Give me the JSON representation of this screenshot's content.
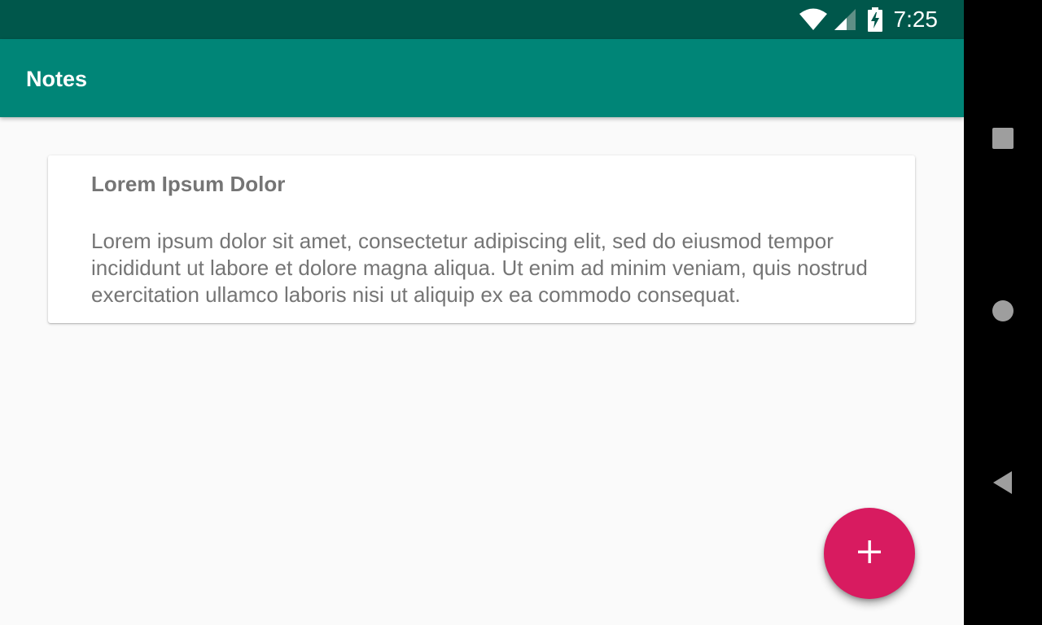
{
  "status_bar": {
    "time": "7:25",
    "icons": [
      "wifi-icon",
      "cellular-signal-icon",
      "battery-charging-icon"
    ],
    "background": "#00574b"
  },
  "app_bar": {
    "title": "Notes",
    "background": "#008577"
  },
  "notes": [
    {
      "title": "Lorem Ipsum Dolor",
      "body": "Lorem ipsum dolor sit amet, consectetur adipiscing elit, sed do eiusmod tempor incididunt ut labore et dolore magna aliqua. Ut enim ad minim veniam, quis nostrud exercitation ullamco laboris nisi ut aliquip ex ea commodo consequat."
    }
  ],
  "fab": {
    "icon": "plus-icon",
    "color": "#d81b60"
  },
  "nav_bar": {
    "buttons": [
      "recents-icon",
      "home-icon",
      "back-icon"
    ]
  }
}
